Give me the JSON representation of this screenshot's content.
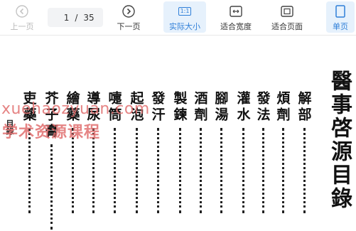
{
  "toolbar": {
    "prev_label": "上一页",
    "page_current": "1",
    "page_sep": "/",
    "page_total": "35",
    "next_label": "下一页",
    "actual_size_label": "实际大小",
    "actual_size_icon_text": "1:1",
    "fit_width_label": "适合宽度",
    "fit_page_label": "适合页面",
    "single_page_label": "单页"
  },
  "document": {
    "title": "醫事啓源目錄",
    "entries": [
      "解部",
      "煩劑",
      "發法",
      "灌水",
      "腳湯",
      "酒劑",
      "製鍊",
      "發汗",
      "起泡",
      "嚏筒",
      "導尿",
      "繪藥",
      "芥子膏",
      "吏藥"
    ],
    "side_note": "目錄",
    "watermark_line1": "xuehaozyuan.com",
    "watermark_line2": "学术资源课程"
  },
  "colors": {
    "accent": "#2f7fd8",
    "active_bg": "#e6f1fc",
    "disabled": "#b8b8b8"
  }
}
